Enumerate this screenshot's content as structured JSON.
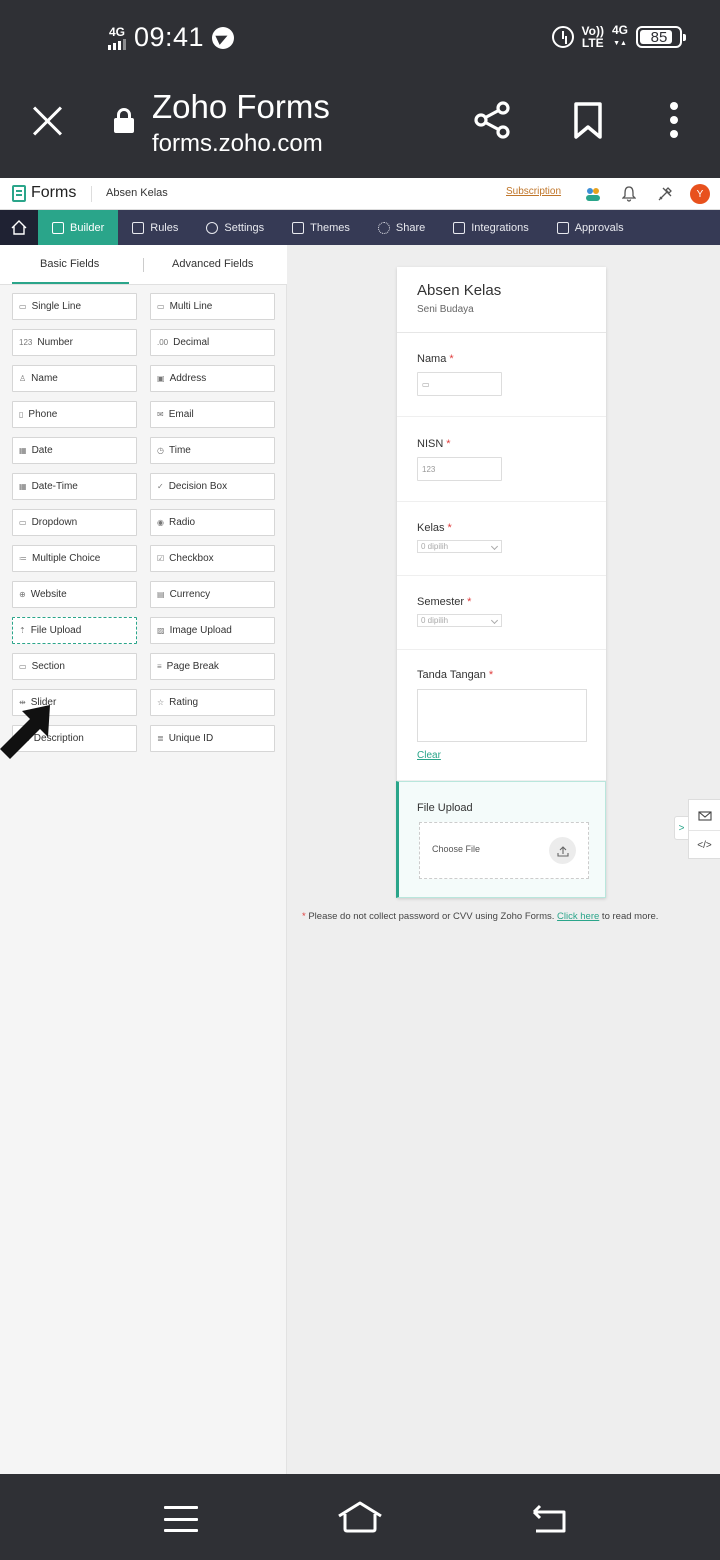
{
  "status": {
    "network": "4G",
    "time": "09:41",
    "volte_top": "Vo))",
    "volte_bottom": "LTE",
    "network2": "4G",
    "network2_sub": "▼▲",
    "battery": "85",
    "battery_level_percent": 85
  },
  "browser": {
    "title": "Zoho Forms",
    "url": "forms.zoho.com"
  },
  "app": {
    "logo": "Forms",
    "form_name": "Absen Kelas",
    "subscription": "Subscription",
    "avatar": "Y"
  },
  "nav": {
    "builder": "Builder",
    "rules": "Rules",
    "settings": "Settings",
    "themes": "Themes",
    "share": "Share",
    "integrations": "Integrations",
    "approvals": "Approvals"
  },
  "tabs": {
    "basic": "Basic Fields",
    "advanced": "Advanced Fields"
  },
  "fields": [
    {
      "label": "Single Line",
      "icon": "▭"
    },
    {
      "label": "Multi Line",
      "icon": "▭"
    },
    {
      "label": "Number",
      "icon": "123"
    },
    {
      "label": "Decimal",
      "icon": ".00"
    },
    {
      "label": "Name",
      "icon": "♙"
    },
    {
      "label": "Address",
      "icon": "▣"
    },
    {
      "label": "Phone",
      "icon": "▯"
    },
    {
      "label": "Email",
      "icon": "✉"
    },
    {
      "label": "Date",
      "icon": "▦"
    },
    {
      "label": "Time",
      "icon": "◷"
    },
    {
      "label": "Date-Time",
      "icon": "▦"
    },
    {
      "label": "Decision Box",
      "icon": "✓"
    },
    {
      "label": "Dropdown",
      "icon": "▭"
    },
    {
      "label": "Radio",
      "icon": "◉"
    },
    {
      "label": "Multiple Choice",
      "icon": "≔"
    },
    {
      "label": "Checkbox",
      "icon": "☑"
    },
    {
      "label": "Website",
      "icon": "⊕"
    },
    {
      "label": "Currency",
      "icon": "▤"
    },
    {
      "label": "File Upload",
      "icon": "⇡"
    },
    {
      "label": "Image Upload",
      "icon": "▨"
    },
    {
      "label": "Section",
      "icon": "▭"
    },
    {
      "label": "Page Break",
      "icon": "≡"
    },
    {
      "label": "Slider",
      "icon": "⇹"
    },
    {
      "label": "Rating",
      "icon": "☆"
    },
    {
      "label": "Description",
      "icon": "Aa"
    },
    {
      "label": "Unique ID",
      "icon": "≣"
    }
  ],
  "form": {
    "title": "Absen Kelas",
    "description": "Seni Budaya",
    "required_mark": "*",
    "nama_label": "Nama",
    "nama_icon": "▭",
    "nisn_label": "NISN",
    "nisn_placeholder": "123",
    "kelas_label": "Kelas",
    "kelas_value": "0 dipilih",
    "semester_label": "Semester",
    "semester_value": "0 dipilih",
    "signature_label": "Tanda Tangan",
    "clear": "Clear",
    "upload_label": "File Upload",
    "choose_file": "Choose File"
  },
  "note": {
    "star": "*",
    "text_before": " Please do not collect password or CVV using Zoho Forms. ",
    "link": "Click here",
    "text_after": " to read more."
  },
  "side_tools": {
    "expand": ">",
    "embed": "</>"
  }
}
